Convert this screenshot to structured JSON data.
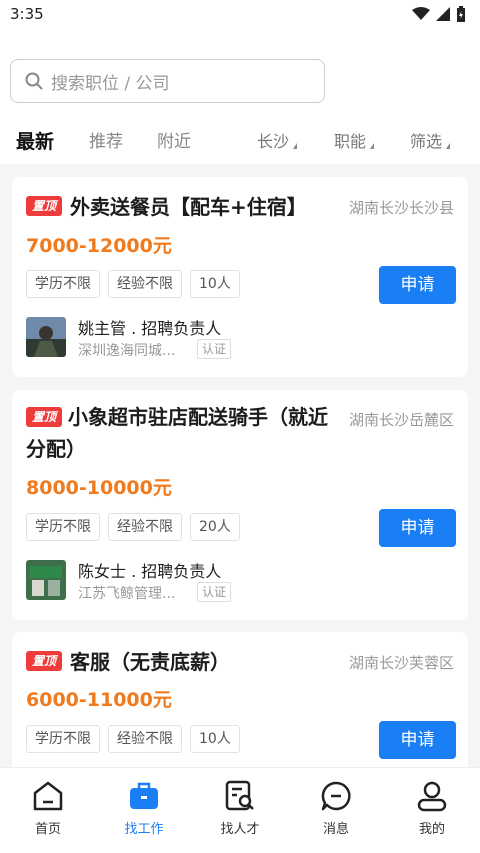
{
  "status": {
    "time": "3:35"
  },
  "search": {
    "placeholder": "搜索职位 / 公司"
  },
  "tabs": [
    {
      "label": "最新",
      "active": true
    },
    {
      "label": "推荐"
    },
    {
      "label": "附近"
    }
  ],
  "filters": [
    {
      "label": "长沙"
    },
    {
      "label": "职能"
    },
    {
      "label": "筛选"
    }
  ],
  "jobs": [
    {
      "badge": "置顶",
      "title": "外卖送餐员【配车+住宿】",
      "location": "湖南长沙长沙县",
      "salary": "7000-12000元",
      "tags": [
        "学历不限",
        "经验不限",
        "10人"
      ],
      "apply_label": "申请",
      "recruiter": "姚主管 . 招聘负责人",
      "company": "深圳逸海同城...",
      "verified": "认证"
    },
    {
      "badge": "置顶",
      "title": "小象超市驻店配送骑手（就近分配）",
      "location": "湖南长沙岳麓区",
      "salary": "8000-10000元",
      "tags": [
        "学历不限",
        "经验不限",
        "20人"
      ],
      "apply_label": "申请",
      "recruiter": "陈女士 . 招聘负责人",
      "company": "江苏飞鲸管理...",
      "verified": "认证"
    },
    {
      "badge": "置顶",
      "title": "客服（无责底薪）",
      "location": "湖南长沙芙蓉区",
      "salary": "6000-11000元",
      "tags": [
        "学历不限",
        "经验不限",
        "10人"
      ],
      "apply_label": "申请"
    }
  ],
  "nav": [
    {
      "label": "首页",
      "icon": "home-icon"
    },
    {
      "label": "找工作",
      "icon": "briefcase-icon",
      "active": true
    },
    {
      "label": "找人才",
      "icon": "resume-search-icon"
    },
    {
      "label": "消息",
      "icon": "message-icon"
    },
    {
      "label": "我的",
      "icon": "profile-icon"
    }
  ],
  "colors": {
    "accent": "#1a7ef4",
    "salary": "#f07a1c",
    "badge": "#ee3b3b"
  }
}
